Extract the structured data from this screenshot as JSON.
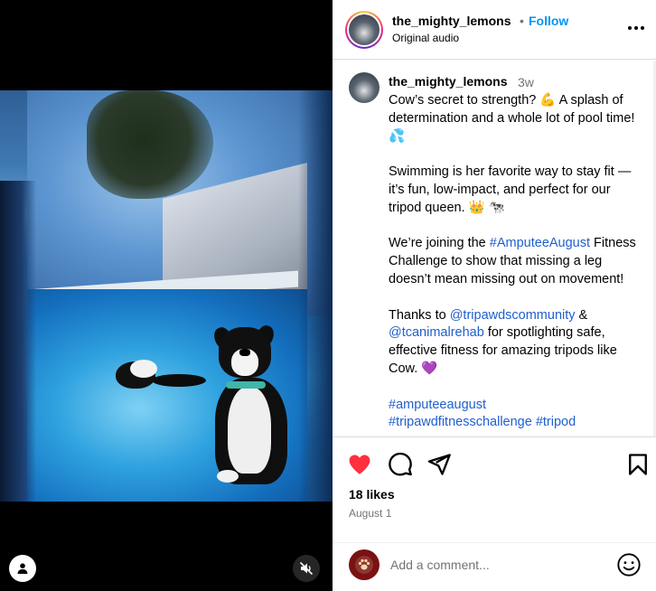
{
  "header": {
    "username": "the_mighty_lemons",
    "separator": "•",
    "follow_label": "Follow",
    "audio_label": "Original audio",
    "more_icon": "more-horizontal-icon"
  },
  "caption": {
    "username": "the_mighty_lemons",
    "time_ago": "3w",
    "p1": "Cow’s secret to strength? 💪 A splash of determination and a whole lot of pool time! 💦",
    "p2": "Swimming is her favorite way to stay fit — it’s fun, low-impact, and perfect for our tripod queen. 👑 🐄",
    "p3_before": "We’re joining the ",
    "p3_tag": "#AmputeeAugust",
    "p3_after": " Fitness Challenge to show that missing a leg doesn’t mean missing out on movement!",
    "p4_before": "Thanks to ",
    "p4_mention1": "@tripawdscommunity",
    "p4_mid": " & ",
    "p4_mention2": "@tcanimalrehab",
    "p4_after": " for spotlighting safe, effective fitness for amazing tripods like Cow. 💜",
    "p5_tag1": "#amputeeaugust",
    "p5_tag2": "#tripawdfitnesschallenge #tripod"
  },
  "actions": {
    "like_icon": "heart-filled-icon",
    "comment_icon": "comment-icon",
    "share_icon": "share-icon",
    "save_icon": "bookmark-icon",
    "like_color": "#ff3040",
    "likes_text": "18 likes",
    "date_text": "August 1"
  },
  "comment": {
    "placeholder": "Add a comment...",
    "emoji_icon": "emoji-smile-icon"
  },
  "media": {
    "user_tag_icon": "user-tag-icon",
    "mute_icon": "volume-muted-icon"
  },
  "colors": {
    "follow": "#0095f6",
    "link": "#1f5fcf",
    "muted_text": "#737373"
  }
}
